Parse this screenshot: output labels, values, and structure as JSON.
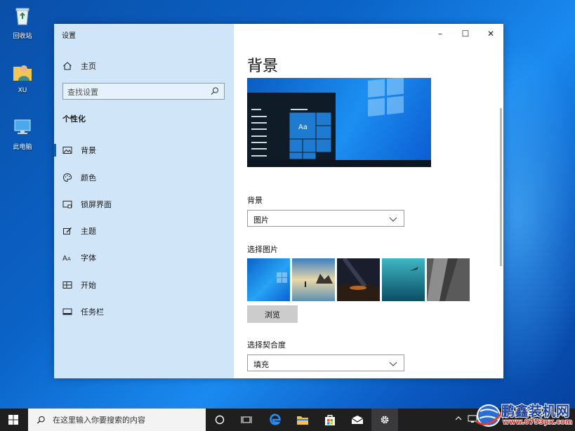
{
  "desktop": {
    "icons": [
      {
        "label": "回收站"
      },
      {
        "label": "XU"
      },
      {
        "label": "此电脑"
      }
    ]
  },
  "window": {
    "title": "设置",
    "nav": {
      "home": "主页",
      "search_placeholder": "查找设置",
      "section": "个性化",
      "items": [
        {
          "label": "背景",
          "icon": "picture-icon",
          "active": true
        },
        {
          "label": "颜色",
          "icon": "palette-icon"
        },
        {
          "label": "锁屏界面",
          "icon": "lock-screen-icon"
        },
        {
          "label": "主题",
          "icon": "theme-brush-icon"
        },
        {
          "label": "字体",
          "icon": "font-icon"
        },
        {
          "label": "开始",
          "icon": "start-tiles-icon"
        },
        {
          "label": "任务栏",
          "icon": "taskbar-icon"
        }
      ]
    },
    "content": {
      "heading": "背景",
      "preview_sample_text": "Aa",
      "background_label": "背景",
      "background_value": "图片",
      "choose_picture_label": "选择图片",
      "browse_label": "浏览",
      "fit_label": "选择契合度",
      "fit_value": "填充"
    },
    "caption": {
      "minimize": "–",
      "maximize": "☐",
      "close": "✕"
    }
  },
  "taskbar": {
    "search_placeholder": "在这里输入你要搜索的内容"
  },
  "watermark": {
    "name": "鹏鑫装机网",
    "url": "www.0753px.com"
  },
  "colors": {
    "accent": "#0067c0",
    "nav_bg": "#cde4f7",
    "taskbar": "#1f1f20"
  }
}
